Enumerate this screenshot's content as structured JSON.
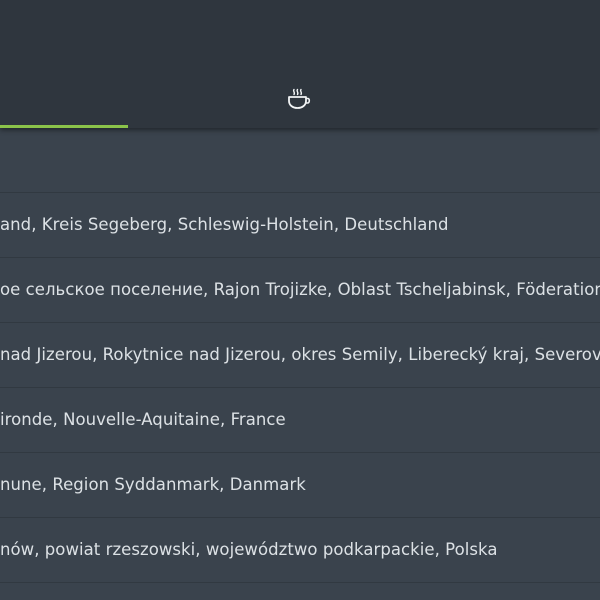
{
  "results": [
    "",
    "and, Kreis Segeberg, Schleswig-Holstein, Deutschland",
    "ое сельское поселение, Rajon Trojizke, Oblast Tscheljabinsk, Föderationskre",
    "nad Jizerou, Rokytnice nad Jizerou, okres Semily, Liberecký kraj, Severových",
    "ironde, Nouvelle-Aquitaine, France",
    "nune, Region Syddanmark, Danmark",
    "nów, powiat rzeszowski, województwo podkarpackie, Polska"
  ],
  "tabs": [
    {
      "name": "active-tab",
      "icon": "none"
    },
    {
      "name": "coffee-tab",
      "icon": "coffee-cup-icon"
    }
  ],
  "colors": {
    "topbar": "#2f363e",
    "background": "#3a434d",
    "accent": "#8bc34a",
    "text": "#dce1e5",
    "divider": "#313941"
  }
}
